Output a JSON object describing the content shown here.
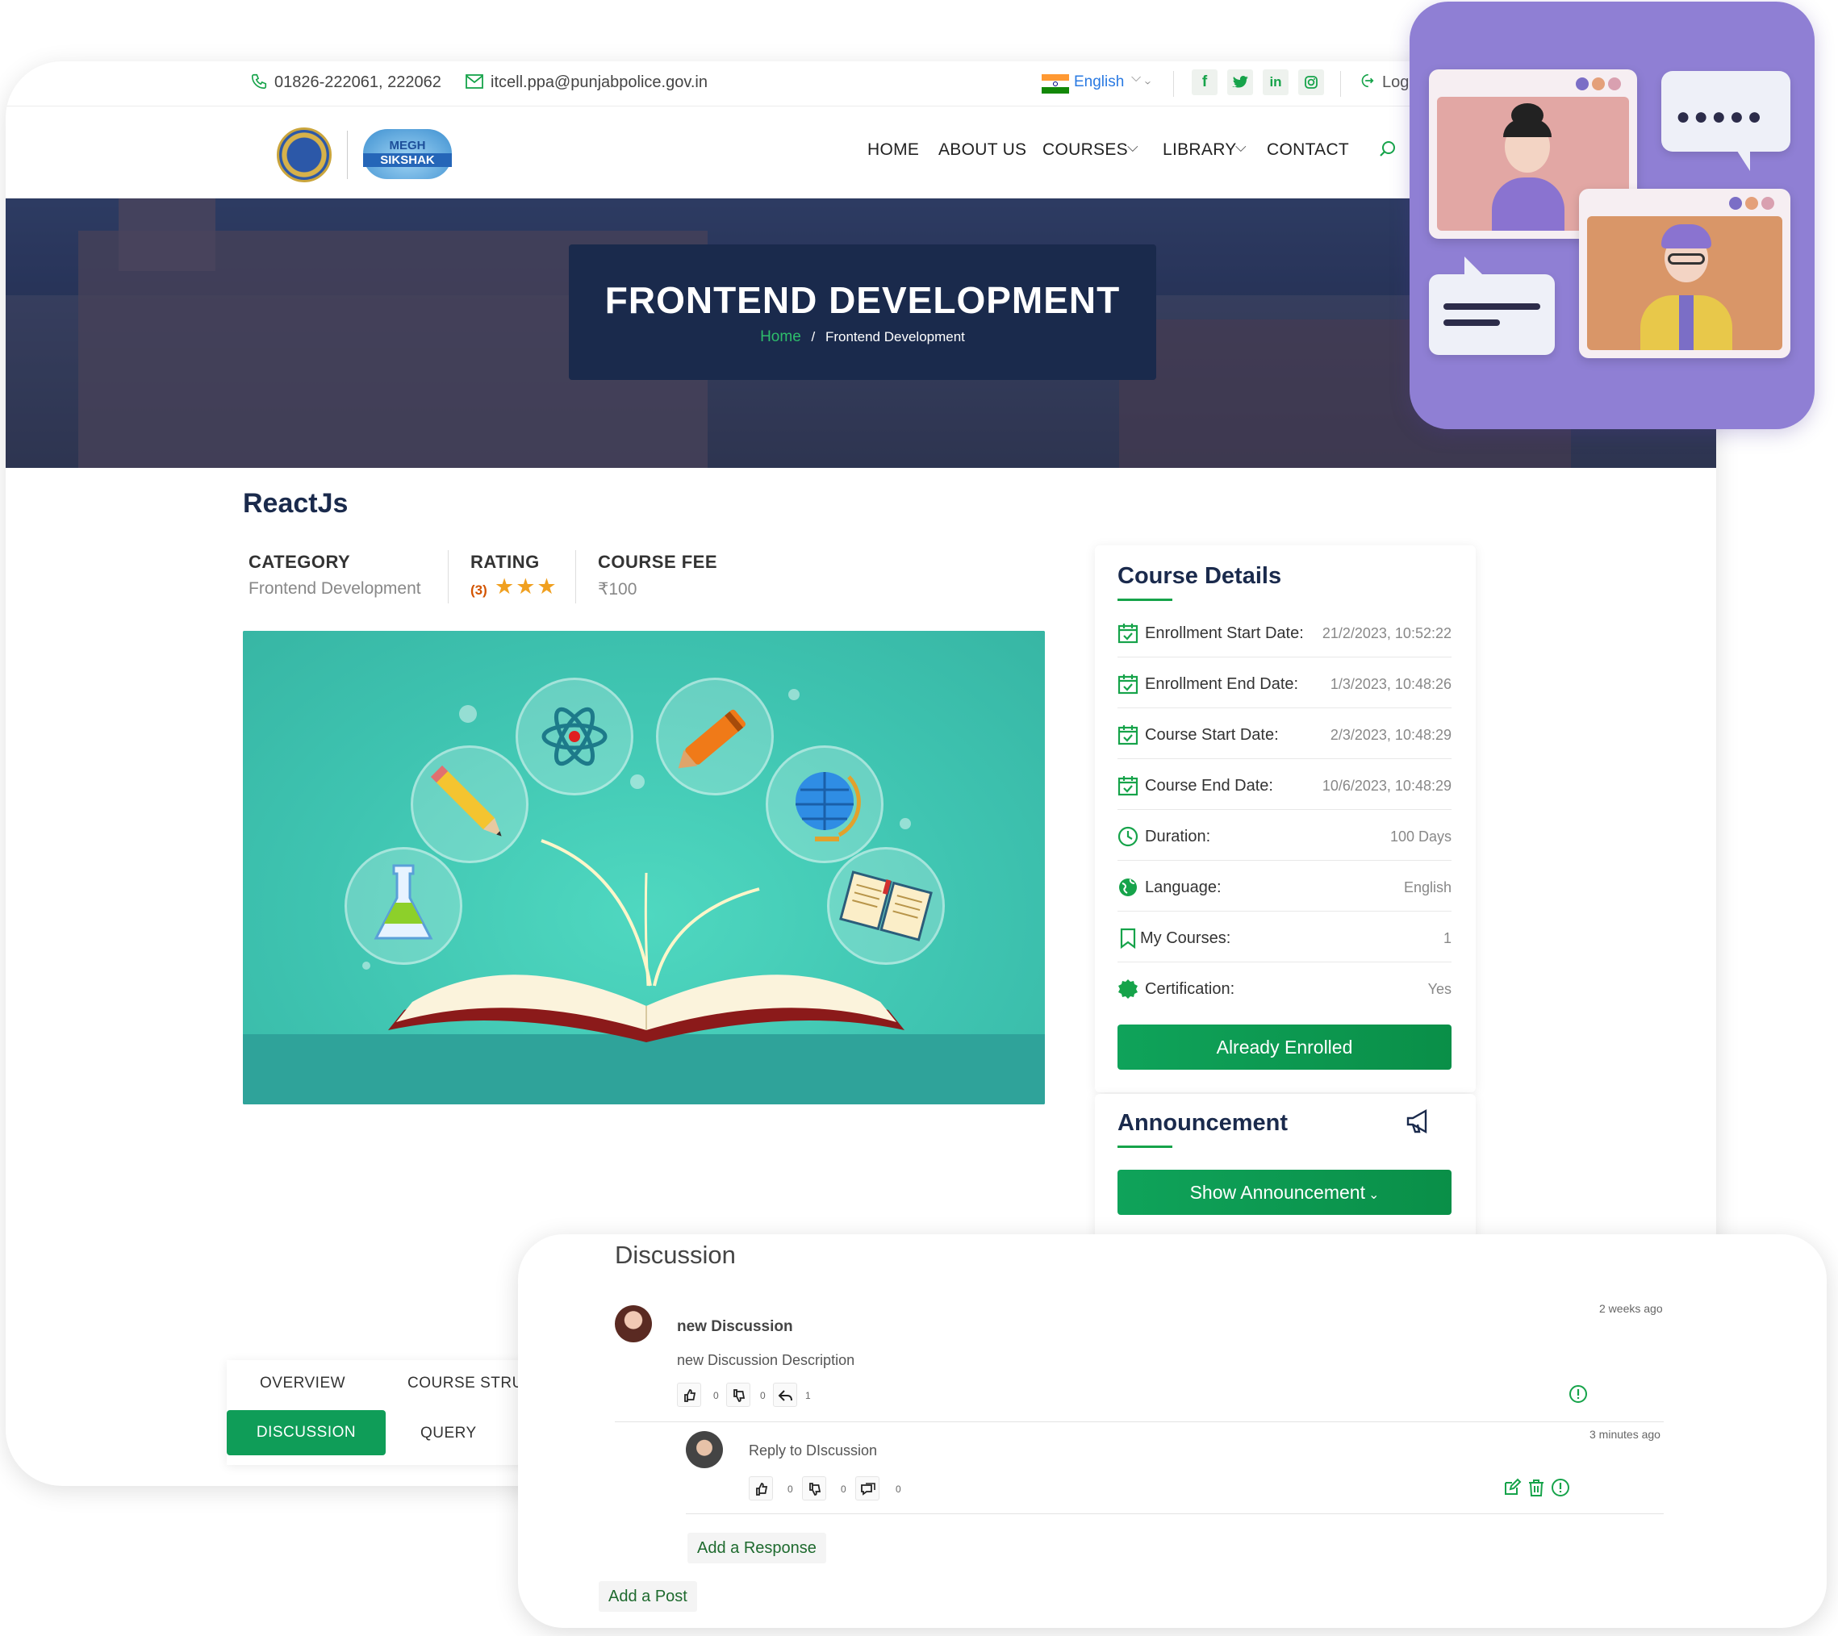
{
  "topbar": {
    "phone": "01826-222061, 222062",
    "email": "itcell.ppa@punjabpolice.gov.in",
    "language": "English",
    "social": [
      "f",
      "t",
      "in",
      "ig"
    ],
    "login_label": "Log"
  },
  "nav": {
    "items": [
      "HOME",
      "ABOUT US",
      "COURSES",
      "LIBRARY",
      "CONTACT"
    ],
    "logo_text_top": "MEGH",
    "logo_text_bottom": "SIKSHAK"
  },
  "hero": {
    "title": "FRONTEND DEVELOPMENT",
    "breadcrumb_home": "Home",
    "breadcrumb_sep": "/",
    "breadcrumb_current": "Frontend Development"
  },
  "course": {
    "name": "ReactJs",
    "category_label": "CATEGORY",
    "category_value": "Frontend Development",
    "rating_label": "RATING",
    "rating_count": "(3)",
    "rating_stars": 3,
    "fee_label": "COURSE FEE",
    "fee_value": "₹100"
  },
  "details": {
    "heading": "Course Details",
    "rows": [
      {
        "label": "Enrollment Start Date:",
        "value": "21/2/2023, 10:52:22",
        "icon": "calendar-check-icon"
      },
      {
        "label": "Enrollment End Date:",
        "value": "1/3/2023, 10:48:26",
        "icon": "calendar-check-icon"
      },
      {
        "label": "Course Start Date:",
        "value": "2/3/2023, 10:48:29",
        "icon": "calendar-check-icon"
      },
      {
        "label": "Course End Date:",
        "value": "10/6/2023, 10:48:29",
        "icon": "calendar-check-icon"
      },
      {
        "label": "Duration:",
        "value": "100 Days",
        "icon": "clock-icon"
      },
      {
        "label": "Language:",
        "value": "English",
        "icon": "globe-icon"
      },
      {
        "label": "My Courses:",
        "value": "1",
        "icon": "bookmark-icon"
      },
      {
        "label": "Certification:",
        "value": "Yes",
        "icon": "badge-icon"
      }
    ],
    "enroll_button": "Already Enrolled"
  },
  "announcement": {
    "heading": "Announcement",
    "button": "Show Announcement"
  },
  "tabs": {
    "overview": "OVERVIEW",
    "structure": "COURSE STRU",
    "discussion": "DISCUSSION",
    "query": "QUERY"
  },
  "discussion": {
    "title": "Discussion",
    "post": {
      "author": "new Discussion",
      "time": "2 weeks ago",
      "body": "new Discussion Description",
      "likes": "0",
      "dislikes": "0",
      "replies": "1"
    },
    "reply": {
      "body": "Reply to DIscussion",
      "time": "3 minutes ago",
      "likes": "0",
      "dislikes": "0",
      "comments": "0"
    },
    "add_response": "Add a Response",
    "add_post": "Add a Post"
  },
  "colors": {
    "accent_green": "#0f9d58",
    "navy": "#1a2a4c",
    "video_card_purple": "#8f7fd4"
  }
}
